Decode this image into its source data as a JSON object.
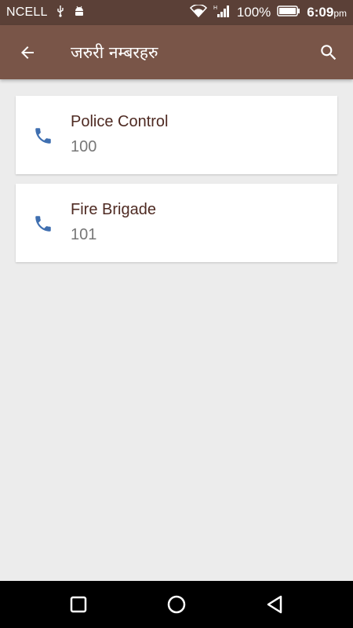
{
  "status_bar": {
    "carrier": "NCELL",
    "network": "H",
    "battery": "100%",
    "time": "6:09",
    "time_suffix": "pm"
  },
  "toolbar": {
    "title": "जरुरी नम्बरहरु",
    "back_icon": "arrow-back-icon",
    "search_icon": "search-icon"
  },
  "contacts": [
    {
      "name": "Police Control",
      "number": "100"
    },
    {
      "name": "Fire Brigade",
      "number": "101"
    }
  ],
  "colors": {
    "statusbar": "#5b4037",
    "toolbar": "#795548",
    "phone_icon": "#3f6fb0",
    "name_text": "#4e2a22"
  }
}
